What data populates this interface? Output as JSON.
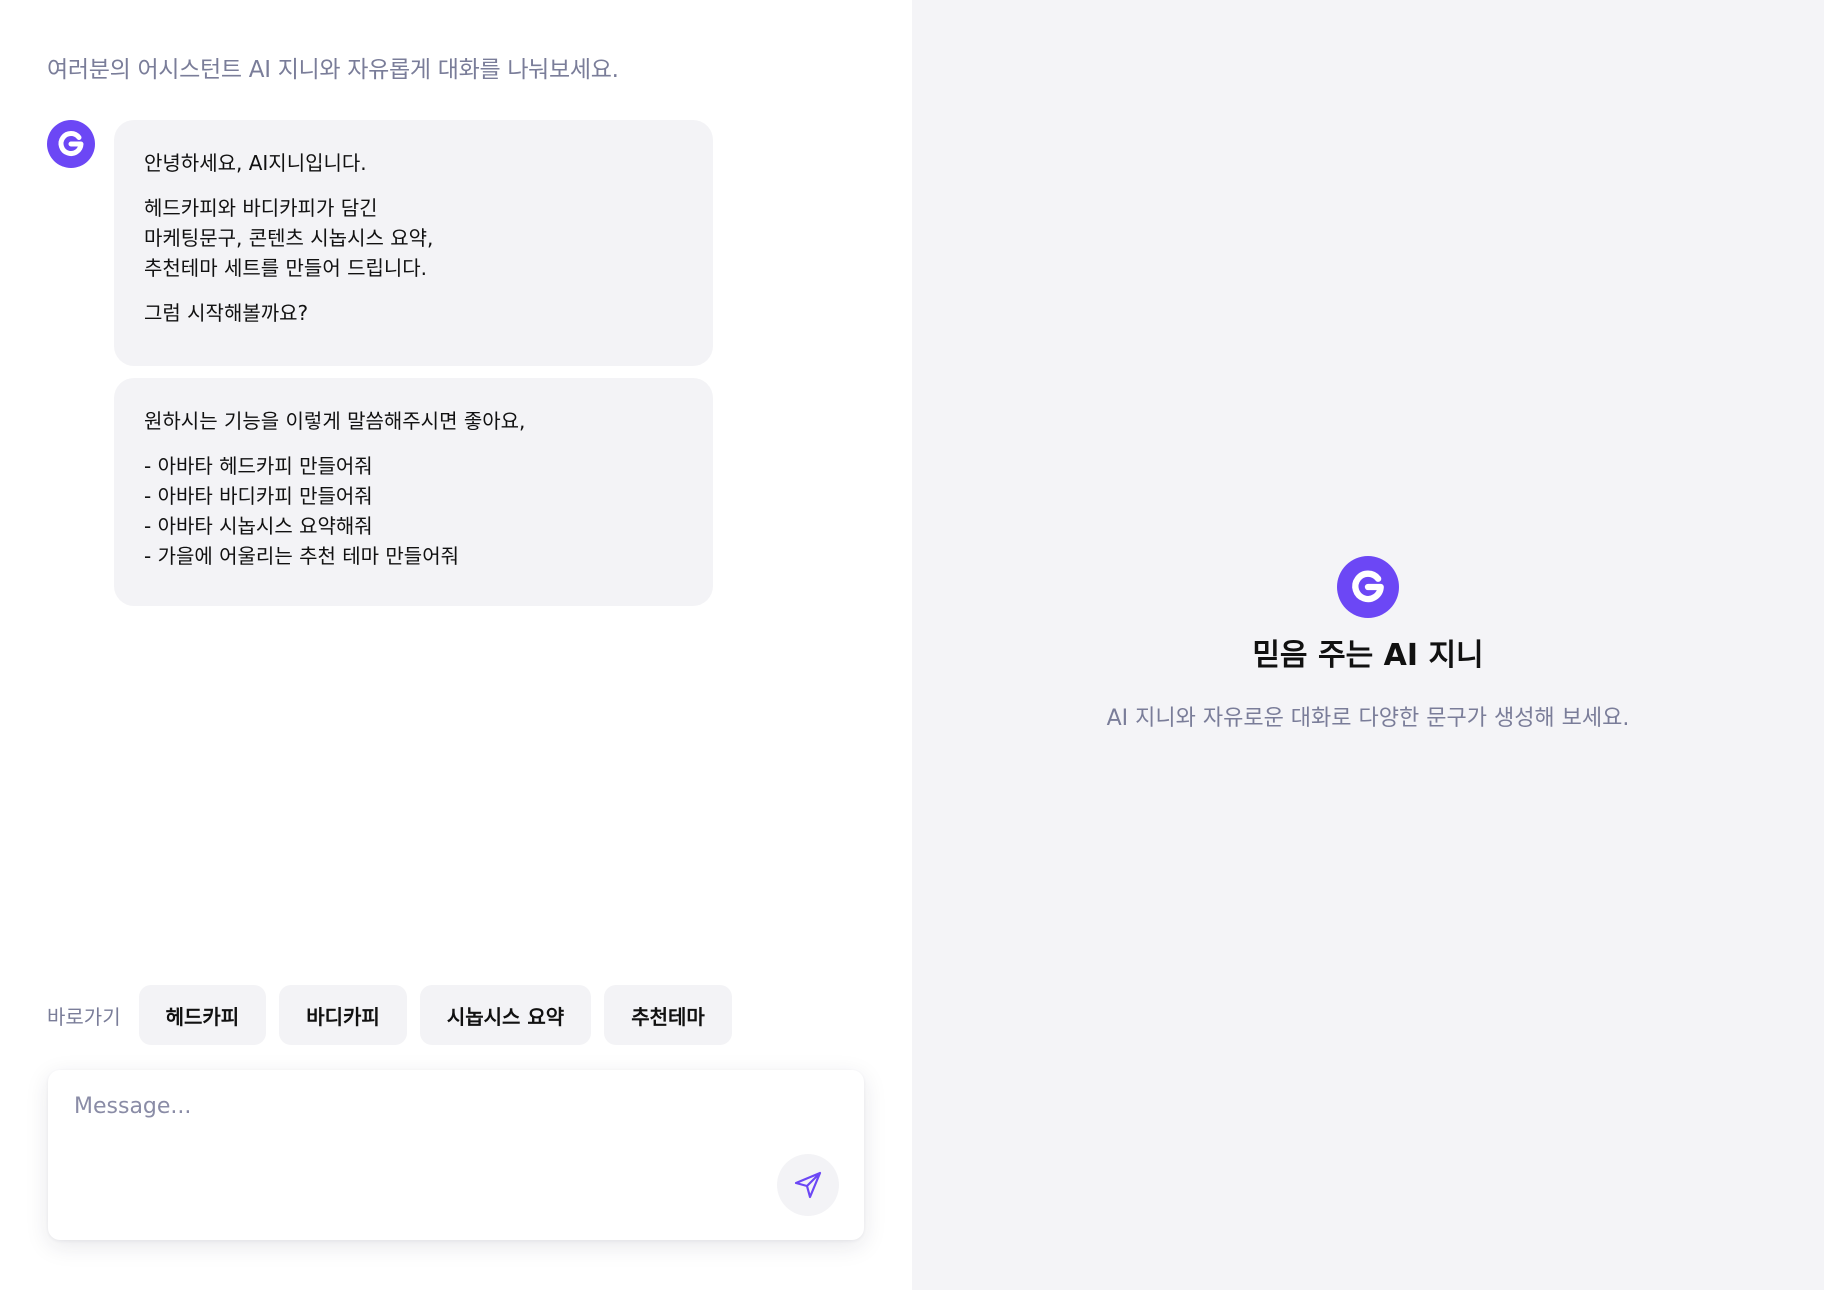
{
  "chat": {
    "intro": "여러분의 어시스턴트 AI 지니와 자유롭게 대화를 나눠보세요.",
    "messages": [
      {
        "paragraphs": [
          "안녕하세요, AI지니입니다.",
          "헤드카피와 바디카피가 담긴\n마케팅문구, 콘텐츠 시놉시스 요약,\n추천테마 세트를 만들어 드립니다.",
          "그럼 시작해볼까요?"
        ]
      },
      {
        "paragraphs": [
          "원하시는 기능을 이렇게 말씀해주시면 좋아요,",
          "- 아바타 헤드카피 만들어줘\n- 아바타 바디카피 만들어줘\n- 아바타 시놉시스 요약해줘\n- 가을에 어울리는 추천 테마 만들어줘"
        ]
      }
    ]
  },
  "shortcuts": {
    "label": "바로가기",
    "chips": [
      "헤드카피",
      "바디카피",
      "시놉시스 요약",
      "추천테마"
    ]
  },
  "composer": {
    "placeholder": "Message...",
    "value": ""
  },
  "preview": {
    "title": "믿음 주는 AI 지니",
    "subtitle": "AI 지니와 자유로운 대화로 다양한 문구가 생성해 보세요."
  },
  "icons": {
    "avatar": "genie-logo-icon",
    "send": "send-icon",
    "preview_logo": "genie-logo-icon"
  },
  "colors": {
    "accent": "#6c47f5",
    "muted_text": "#7a7d99",
    "bubble_bg": "#f3f3f6",
    "panel_bg": "#f4f4f7"
  }
}
